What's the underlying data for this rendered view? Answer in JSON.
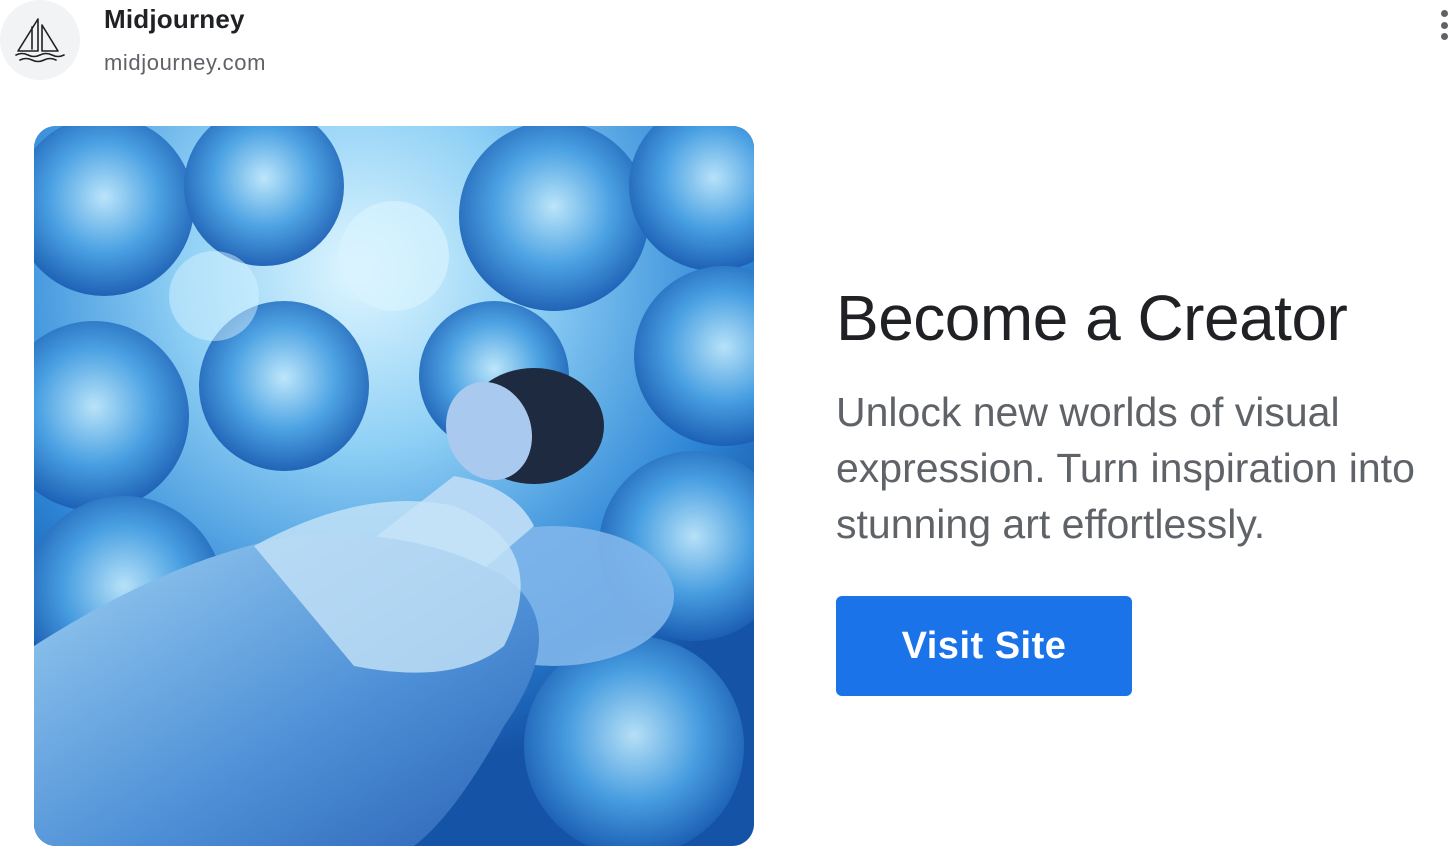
{
  "advertiser": {
    "name": "Midjourney",
    "domain": "midjourney.com",
    "logo_icon": "sailboat-logo-icon"
  },
  "menu": {
    "icon": "more-vertical-icon"
  },
  "hero": {
    "image_subject": "woman sleeping among glowing blue clouds"
  },
  "ad": {
    "headline": "Become a Creator",
    "description": "Unlock new worlds of visual expression. Turn inspiration into stunning art effortlessly.",
    "cta_label": "Visit Site"
  },
  "colors": {
    "cta_background": "#1a73e8",
    "headline_text": "#202124",
    "body_text": "#5f6368"
  }
}
